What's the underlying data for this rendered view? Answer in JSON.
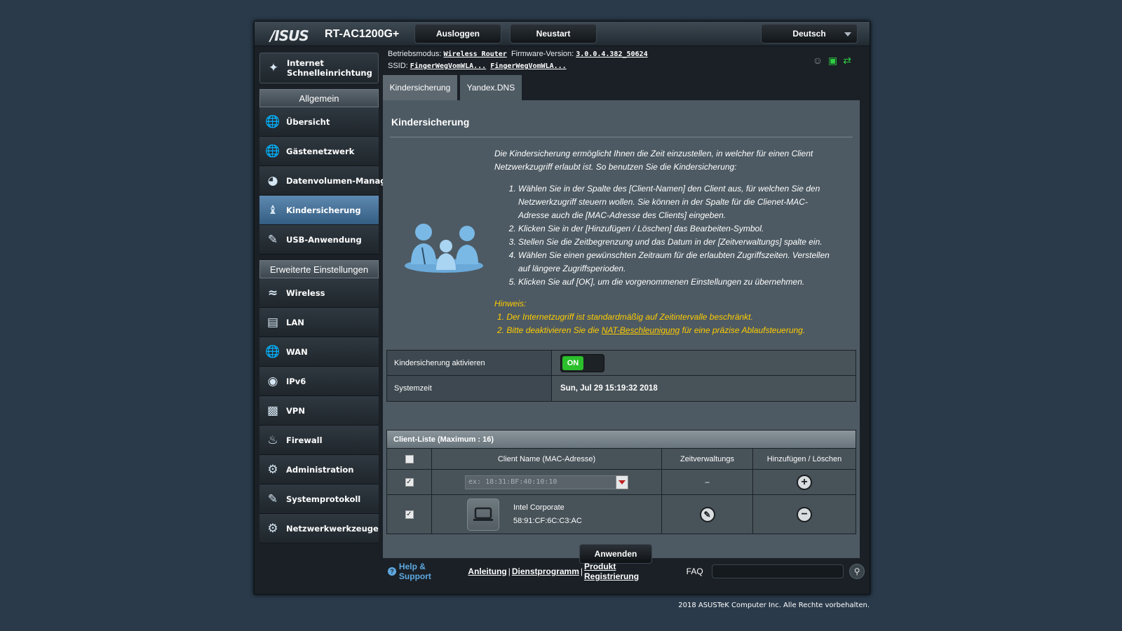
{
  "header": {
    "brand": "/ISUS",
    "model": "RT-AC1200G+",
    "logout_label": "Ausloggen",
    "restart_label": "Neustart",
    "language": "Deutsch"
  },
  "info": {
    "mode_label": "Betriebsmodus:",
    "mode_value": "Wireless Router",
    "firmware_label": "Firmware-Version:",
    "firmware_value": "3.0.0.4.382_50624",
    "ssid_label": "SSID:",
    "ssid_1": "FingerWegVomWLA...",
    "ssid_2": "FingerWegVomWLA..."
  },
  "sidebar": {
    "quick_setup": "Internet Schnelleinrichtung",
    "general_heading": "Allgemein",
    "general_items": [
      {
        "label": "Übersicht",
        "icon": "globe-icon"
      },
      {
        "label": "Gästenetzwerk",
        "icon": "guest-network-icon"
      },
      {
        "label": "Datenvolumen-Manag",
        "icon": "traffic-meter-icon"
      },
      {
        "label": "Kindersicherung",
        "icon": "parental-control-icon"
      },
      {
        "label": "USB-Anwendung",
        "icon": "usb-icon"
      }
    ],
    "advanced_heading": "Erweiterte Einstellungen",
    "advanced_items": [
      {
        "label": "Wireless",
        "icon": "wireless-icon"
      },
      {
        "label": "LAN",
        "icon": "lan-icon"
      },
      {
        "label": "WAN",
        "icon": "wan-globe-icon"
      },
      {
        "label": "IPv6",
        "icon": "ipv6-icon"
      },
      {
        "label": "VPN",
        "icon": "vpn-icon"
      },
      {
        "label": "Firewall",
        "icon": "firewall-icon"
      },
      {
        "label": "Administration",
        "icon": "admin-gear-icon"
      },
      {
        "label": "Systemprotokoll",
        "icon": "system-log-icon"
      },
      {
        "label": "Netzwerkwerkzeuge",
        "icon": "network-tools-icon"
      }
    ]
  },
  "tabs": [
    "Kindersicherung",
    "Yandex.DNS"
  ],
  "content": {
    "title": "Kindersicherung",
    "intro": "Die Kindersicherung ermöglicht Ihnen die Zeit einzustellen, in welcher für einen Client Netzwerkzugriff erlaubt ist. So benutzen Sie die Kindersicherung:",
    "steps": [
      "Wählen Sie in der Spalte des [Client-Namen] den Client aus, für welchen Sie den Netzwerkzugriff steuern wollen. Sie können in der Spalte für die Clienet-MAC-Adresse auch die [MAC-Adresse des Clients] eingeben.",
      "Klicken Sie in der [Hinzufügen / Löschen] das Bearbeiten-Symbol.",
      "Stellen Sie die Zeitbegrenzung und das Datum in der [Zeitverwaltungs] spalte ein.",
      "Wählen Sie einen gewünschten Zeitraum für die erlaubten Zugriffszeiten. Verstellen auf längere Zugriffsperioden.",
      "Klicken Sie auf [OK], um die vorgenommenen Einstellungen zu übernehmen."
    ],
    "note_heading": "Hinweis:",
    "note_1": "1. Der Internetzugriff ist standardmäßig auf Zeitintervalle beschränkt.",
    "note_2_prefix": "2. Bitte deaktivieren Sie die ",
    "note_2_link": "NAT-Beschleunigung",
    "note_2_suffix": " für eine präzise Ablaufsteuerung.",
    "enable_label": "Kindersicherung aktivieren",
    "enable_state": "ON",
    "systime_label": "Systemzeit",
    "systime_value": "Sun, Jul 29 15:19:32 2018"
  },
  "client_list": {
    "heading": "Client-Liste (Maximum : 16)",
    "col_name": "Client Name (MAC-Adresse)",
    "col_time": "Zeitverwaltungs",
    "col_addremove": "Hinzufügen / Löschen",
    "input_placeholder": "ex: 18:31:BF:40:10:10",
    "empty_time": "–",
    "check_mark": "✓",
    "clients": [
      {
        "name": "Intel Corporate",
        "mac": "58:91:CF:6C:C3:AC"
      }
    ]
  },
  "apply_label": "Anwenden",
  "footer": {
    "help": "Help & Support",
    "links": [
      "Anleitung",
      "Dienstprogramm",
      "Produkt Registrierung"
    ],
    "faq": "FAQ",
    "copyright": "2018 ASUSTeK Computer Inc. Alle Rechte vorbehalten."
  }
}
